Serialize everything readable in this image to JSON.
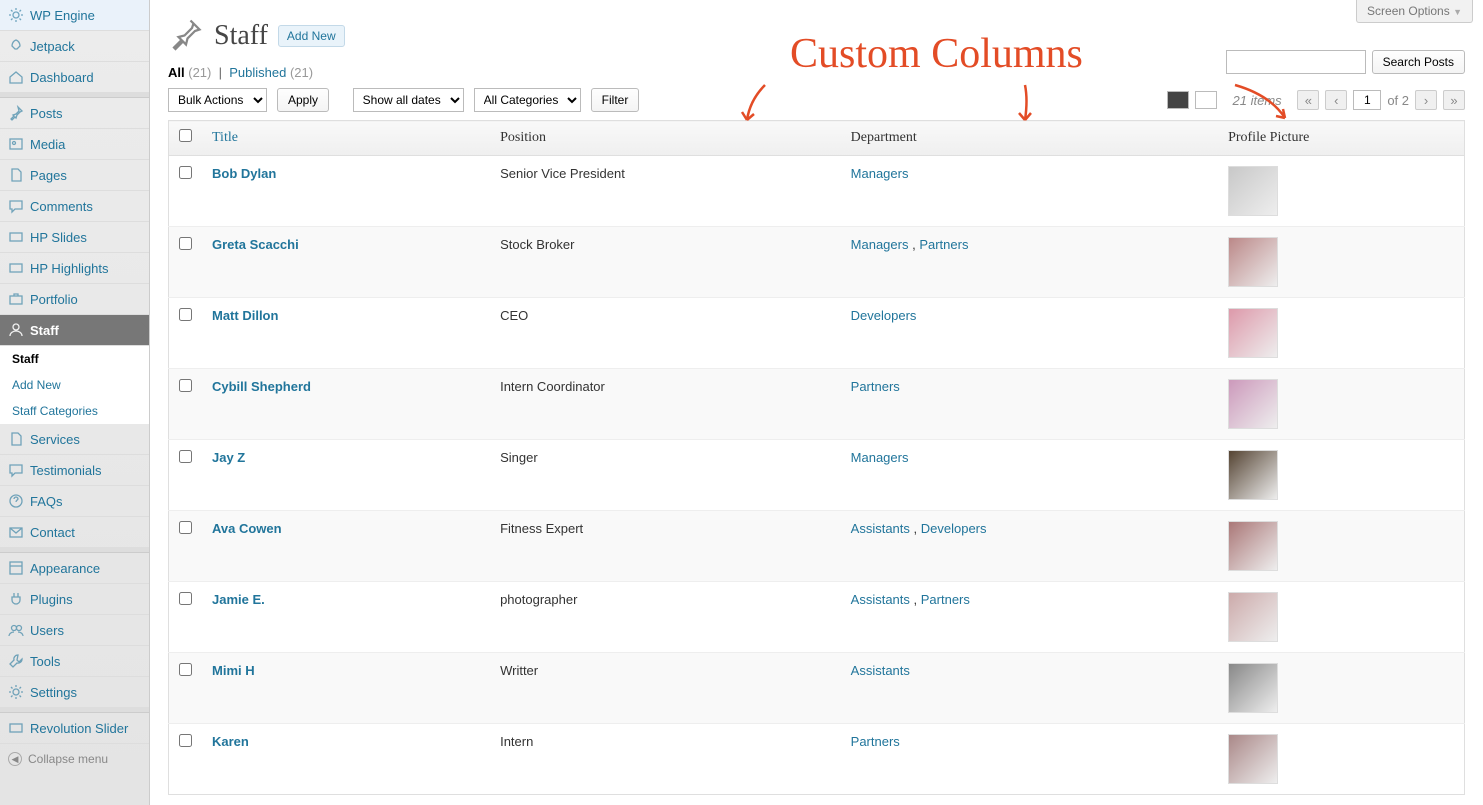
{
  "screen_options": "Screen Options",
  "page_title": "Staff",
  "add_new": "Add New",
  "subsub": {
    "all_label": "All",
    "all_count": "(21)",
    "published_label": "Published",
    "published_count": "(21)",
    "sep": "|"
  },
  "bulk_actions": "Bulk Actions",
  "apply": "Apply",
  "show_all_dates": "Show all dates",
  "all_categories": "All Categories",
  "filter": "Filter",
  "search_btn": "Search Posts",
  "paging": {
    "items": "21 items",
    "current": "1",
    "of": "of 2"
  },
  "columns": {
    "title": "Title",
    "position": "Position",
    "department": "Department",
    "picture": "Profile Picture"
  },
  "rows": [
    {
      "title": "Bob Dylan",
      "position": "Senior Vice President",
      "dept": [
        "Managers"
      ]
    },
    {
      "title": "Greta Scacchi",
      "position": "Stock Broker",
      "dept": [
        "Managers",
        "Partners"
      ]
    },
    {
      "title": "Matt Dillon",
      "position": "CEO",
      "dept": [
        "Developers"
      ]
    },
    {
      "title": "Cybill Shepherd",
      "position": "Intern Coordinator",
      "dept": [
        "Partners"
      ]
    },
    {
      "title": "Jay Z",
      "position": "Singer",
      "dept": [
        "Managers"
      ]
    },
    {
      "title": "Ava Cowen",
      "position": "Fitness Expert",
      "dept": [
        "Assistants",
        "Developers"
      ]
    },
    {
      "title": "Jamie E.",
      "position": "photographer",
      "dept": [
        "Assistants",
        "Partners"
      ]
    },
    {
      "title": "Mimi H",
      "position": "Writter",
      "dept": [
        "Assistants"
      ]
    },
    {
      "title": "Karen",
      "position": "Intern",
      "dept": [
        "Partners"
      ]
    }
  ],
  "profile_colors": [
    "#c8c8c8",
    "#b88",
    "#d9a",
    "#c9b",
    "#543",
    "#a77",
    "#caa",
    "#888",
    "#a88"
  ],
  "menu": [
    {
      "label": "WP Engine",
      "icon": "gear-icon"
    },
    {
      "label": "Jetpack",
      "icon": "rocket-icon"
    },
    {
      "label": "Dashboard",
      "icon": "home-icon"
    },
    "sep",
    {
      "label": "Posts",
      "icon": "pin-icon"
    },
    {
      "label": "Media",
      "icon": "media-icon"
    },
    {
      "label": "Pages",
      "icon": "page-icon"
    },
    {
      "label": "Comments",
      "icon": "comment-icon"
    },
    {
      "label": "HP Slides",
      "icon": "slide-icon"
    },
    {
      "label": "HP Highlights",
      "icon": "slide-icon"
    },
    {
      "label": "Portfolio",
      "icon": "briefcase-icon"
    },
    {
      "label": "Staff",
      "icon": "user-icon",
      "current": true
    },
    "submenu",
    {
      "label": "Services",
      "icon": "page-icon"
    },
    {
      "label": "Testimonials",
      "icon": "comment-icon"
    },
    {
      "label": "FAQs",
      "icon": "help-icon"
    },
    {
      "label": "Contact",
      "icon": "mail-icon"
    },
    "sep",
    {
      "label": "Appearance",
      "icon": "theme-icon"
    },
    {
      "label": "Plugins",
      "icon": "plug-icon"
    },
    {
      "label": "Users",
      "icon": "users-icon"
    },
    {
      "label": "Tools",
      "icon": "tool-icon"
    },
    {
      "label": "Settings",
      "icon": "gear-icon"
    },
    "sep",
    {
      "label": "Revolution Slider",
      "icon": "slide-icon"
    }
  ],
  "submenu": [
    {
      "label": "Staff",
      "current": true
    },
    {
      "label": "Add New"
    },
    {
      "label": "Staff Categories"
    }
  ],
  "collapse": "Collapse menu",
  "annotation": "Custom Columns"
}
